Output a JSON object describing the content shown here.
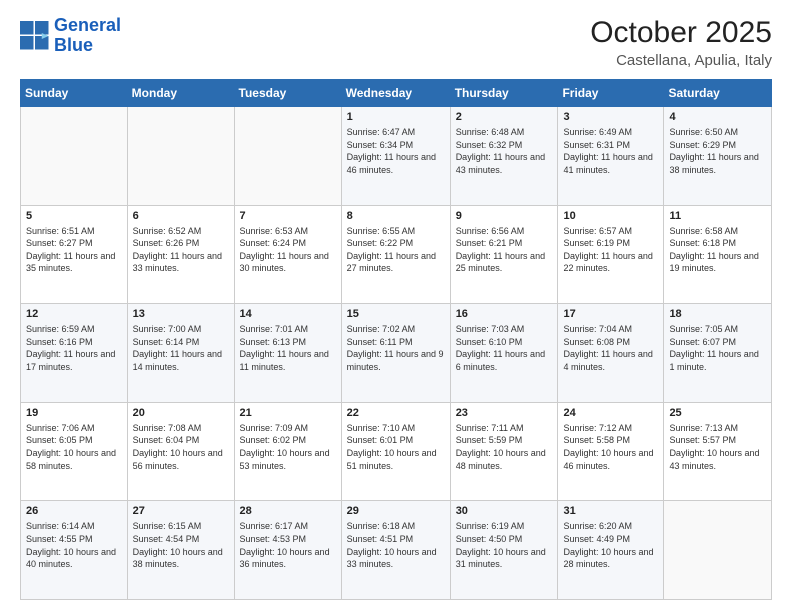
{
  "logo": {
    "line1": "General",
    "line2": "Blue"
  },
  "title": "October 2025",
  "subtitle": "Castellana, Apulia, Italy",
  "days_header": [
    "Sunday",
    "Monday",
    "Tuesday",
    "Wednesday",
    "Thursday",
    "Friday",
    "Saturday"
  ],
  "weeks": [
    [
      {
        "day": "",
        "info": ""
      },
      {
        "day": "",
        "info": ""
      },
      {
        "day": "",
        "info": ""
      },
      {
        "day": "1",
        "info": "Sunrise: 6:47 AM\nSunset: 6:34 PM\nDaylight: 11 hours and 46 minutes."
      },
      {
        "day": "2",
        "info": "Sunrise: 6:48 AM\nSunset: 6:32 PM\nDaylight: 11 hours and 43 minutes."
      },
      {
        "day": "3",
        "info": "Sunrise: 6:49 AM\nSunset: 6:31 PM\nDaylight: 11 hours and 41 minutes."
      },
      {
        "day": "4",
        "info": "Sunrise: 6:50 AM\nSunset: 6:29 PM\nDaylight: 11 hours and 38 minutes."
      }
    ],
    [
      {
        "day": "5",
        "info": "Sunrise: 6:51 AM\nSunset: 6:27 PM\nDaylight: 11 hours and 35 minutes."
      },
      {
        "day": "6",
        "info": "Sunrise: 6:52 AM\nSunset: 6:26 PM\nDaylight: 11 hours and 33 minutes."
      },
      {
        "day": "7",
        "info": "Sunrise: 6:53 AM\nSunset: 6:24 PM\nDaylight: 11 hours and 30 minutes."
      },
      {
        "day": "8",
        "info": "Sunrise: 6:55 AM\nSunset: 6:22 PM\nDaylight: 11 hours and 27 minutes."
      },
      {
        "day": "9",
        "info": "Sunrise: 6:56 AM\nSunset: 6:21 PM\nDaylight: 11 hours and 25 minutes."
      },
      {
        "day": "10",
        "info": "Sunrise: 6:57 AM\nSunset: 6:19 PM\nDaylight: 11 hours and 22 minutes."
      },
      {
        "day": "11",
        "info": "Sunrise: 6:58 AM\nSunset: 6:18 PM\nDaylight: 11 hours and 19 minutes."
      }
    ],
    [
      {
        "day": "12",
        "info": "Sunrise: 6:59 AM\nSunset: 6:16 PM\nDaylight: 11 hours and 17 minutes."
      },
      {
        "day": "13",
        "info": "Sunrise: 7:00 AM\nSunset: 6:14 PM\nDaylight: 11 hours and 14 minutes."
      },
      {
        "day": "14",
        "info": "Sunrise: 7:01 AM\nSunset: 6:13 PM\nDaylight: 11 hours and 11 minutes."
      },
      {
        "day": "15",
        "info": "Sunrise: 7:02 AM\nSunset: 6:11 PM\nDaylight: 11 hours and 9 minutes."
      },
      {
        "day": "16",
        "info": "Sunrise: 7:03 AM\nSunset: 6:10 PM\nDaylight: 11 hours and 6 minutes."
      },
      {
        "day": "17",
        "info": "Sunrise: 7:04 AM\nSunset: 6:08 PM\nDaylight: 11 hours and 4 minutes."
      },
      {
        "day": "18",
        "info": "Sunrise: 7:05 AM\nSunset: 6:07 PM\nDaylight: 11 hours and 1 minute."
      }
    ],
    [
      {
        "day": "19",
        "info": "Sunrise: 7:06 AM\nSunset: 6:05 PM\nDaylight: 10 hours and 58 minutes."
      },
      {
        "day": "20",
        "info": "Sunrise: 7:08 AM\nSunset: 6:04 PM\nDaylight: 10 hours and 56 minutes."
      },
      {
        "day": "21",
        "info": "Sunrise: 7:09 AM\nSunset: 6:02 PM\nDaylight: 10 hours and 53 minutes."
      },
      {
        "day": "22",
        "info": "Sunrise: 7:10 AM\nSunset: 6:01 PM\nDaylight: 10 hours and 51 minutes."
      },
      {
        "day": "23",
        "info": "Sunrise: 7:11 AM\nSunset: 5:59 PM\nDaylight: 10 hours and 48 minutes."
      },
      {
        "day": "24",
        "info": "Sunrise: 7:12 AM\nSunset: 5:58 PM\nDaylight: 10 hours and 46 minutes."
      },
      {
        "day": "25",
        "info": "Sunrise: 7:13 AM\nSunset: 5:57 PM\nDaylight: 10 hours and 43 minutes."
      }
    ],
    [
      {
        "day": "26",
        "info": "Sunrise: 6:14 AM\nSunset: 4:55 PM\nDaylight: 10 hours and 40 minutes."
      },
      {
        "day": "27",
        "info": "Sunrise: 6:15 AM\nSunset: 4:54 PM\nDaylight: 10 hours and 38 minutes."
      },
      {
        "day": "28",
        "info": "Sunrise: 6:17 AM\nSunset: 4:53 PM\nDaylight: 10 hours and 36 minutes."
      },
      {
        "day": "29",
        "info": "Sunrise: 6:18 AM\nSunset: 4:51 PM\nDaylight: 10 hours and 33 minutes."
      },
      {
        "day": "30",
        "info": "Sunrise: 6:19 AM\nSunset: 4:50 PM\nDaylight: 10 hours and 31 minutes."
      },
      {
        "day": "31",
        "info": "Sunrise: 6:20 AM\nSunset: 4:49 PM\nDaylight: 10 hours and 28 minutes."
      },
      {
        "day": "",
        "info": ""
      }
    ]
  ]
}
